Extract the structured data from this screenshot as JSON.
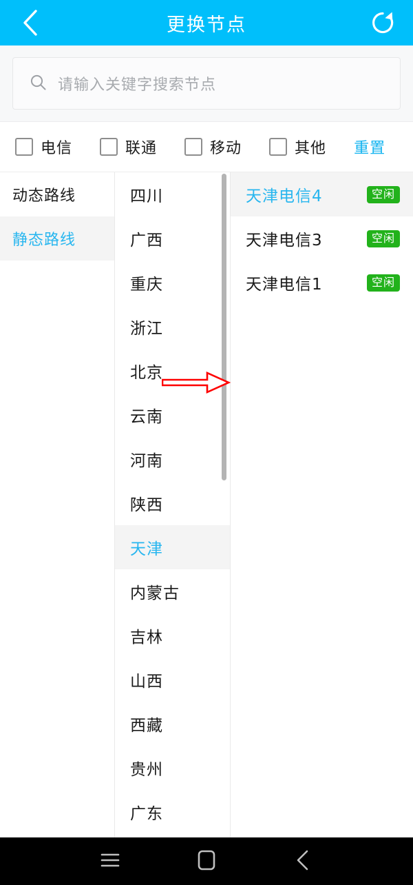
{
  "header": {
    "title": "更换节点",
    "back_icon": "chevron-left-icon",
    "refresh_icon": "refresh-icon",
    "background": "#00bffb"
  },
  "search": {
    "placeholder": "请输入关键字搜索节点",
    "value": "",
    "icon": "search-icon"
  },
  "filters": {
    "items": [
      {
        "label": "电信",
        "checked": false
      },
      {
        "label": "联通",
        "checked": false
      },
      {
        "label": "移动",
        "checked": false
      },
      {
        "label": "其他",
        "checked": false
      }
    ],
    "reset_label": "重置",
    "reset_color": "#14b4f0"
  },
  "sidebar": {
    "items": [
      {
        "label": "动态路线",
        "selected": false
      },
      {
        "label": "静态路线",
        "selected": true
      }
    ]
  },
  "provinces": {
    "items": [
      {
        "label": "四川",
        "selected": false
      },
      {
        "label": "广西",
        "selected": false
      },
      {
        "label": "重庆",
        "selected": false
      },
      {
        "label": "浙江",
        "selected": false
      },
      {
        "label": "北京",
        "selected": false
      },
      {
        "label": "云南",
        "selected": false
      },
      {
        "label": "河南",
        "selected": false
      },
      {
        "label": "陕西",
        "selected": false
      },
      {
        "label": "天津",
        "selected": true
      },
      {
        "label": "内蒙古",
        "selected": false
      },
      {
        "label": "吉林",
        "selected": false
      },
      {
        "label": "山西",
        "selected": false
      },
      {
        "label": "西藏",
        "selected": false
      },
      {
        "label": "贵州",
        "selected": false
      },
      {
        "label": "广东",
        "selected": false
      }
    ]
  },
  "nodes": {
    "items": [
      {
        "name": "天津电信4",
        "status": "空闲",
        "selected": true
      },
      {
        "name": "天津电信3",
        "status": "空闲",
        "selected": false
      },
      {
        "name": "天津电信1",
        "status": "空闲",
        "selected": false
      }
    ],
    "status_color": "#22b21b",
    "selected_color": "#28b6ef"
  },
  "annotation": {
    "arrow_color": "#fe0000",
    "arrow_icon": "right-arrow-annotation"
  },
  "navbar": {
    "menu_icon": "menu-icon",
    "home_icon": "home-square-icon",
    "back_icon": "chevron-left-icon"
  }
}
